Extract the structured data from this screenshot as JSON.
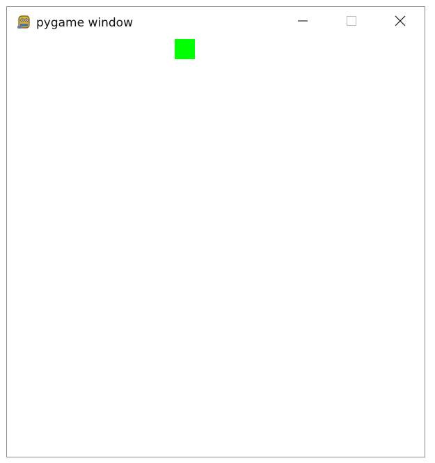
{
  "window": {
    "title": "pygame window",
    "icon": "pygame-snake-icon",
    "controls": {
      "minimize_icon": "minimize-icon",
      "maximize_icon": "maximize-icon",
      "close_icon": "close-icon"
    }
  },
  "game": {
    "background_color": "#ffffff",
    "player_color": "#00ff00"
  }
}
